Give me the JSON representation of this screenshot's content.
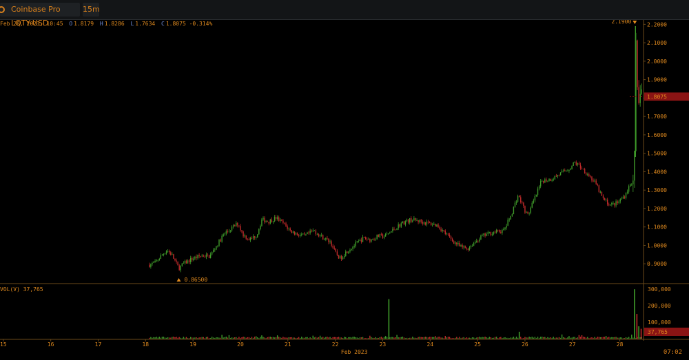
{
  "toolbar": {
    "symbol_tab": "Coinbase Pro LQTY-USD",
    "interval_tab": "15m",
    "settings_icon": "gear-icon"
  },
  "ohlc": {
    "date": "Feb 28, 2023, 10:45",
    "o_label": "O",
    "o": "1.8179",
    "h_label": "H",
    "h": "1.8286",
    "l_label": "L",
    "l": "1.7634",
    "c_label": "C",
    "c": "1.8075",
    "change": "-0.314%"
  },
  "volume_legend": "VOL(V) 37,765",
  "footer_time": "07:02",
  "colors": {
    "up": "#3f9b2a",
    "down": "#c22b2b",
    "accent": "#e08a1e",
    "price_tag": "#8a1414"
  },
  "chart_data": {
    "type": "line",
    "title": "Coinbase Pro LQTY-USD",
    "y_ticks": [
      "0.9000",
      "1.0000",
      "1.1000",
      "1.2000",
      "1.3000",
      "1.4000",
      "1.5000",
      "1.6000",
      "1.7000",
      "1.8000",
      "1.9000",
      "2.0000",
      "2.1000",
      "2.2000"
    ],
    "ylim": [
      0.8,
      2.22
    ],
    "x_ticks": [
      "15",
      "16",
      "17",
      "18",
      "19",
      "20",
      "21",
      "22",
      "23",
      "24",
      "25",
      "26",
      "27",
      "28"
    ],
    "x_month_label": "Feb 2023",
    "xlim": [
      14.93,
      28.5
    ],
    "last_price_label": "1.8075",
    "last_price": 1.8075,
    "high_marker": {
      "label": "2.1900",
      "value": 2.19,
      "x": 28.33
    },
    "low_marker": {
      "label": "0.86500",
      "value": 0.865,
      "x": 18.7
    },
    "price_series": [
      [
        18.08,
        0.895
      ],
      [
        18.2,
        0.905
      ],
      [
        18.3,
        0.935
      ],
      [
        18.45,
        0.975
      ],
      [
        18.55,
        0.95
      ],
      [
        18.7,
        0.875
      ],
      [
        18.8,
        0.9
      ],
      [
        19.0,
        0.93
      ],
      [
        19.2,
        0.945
      ],
      [
        19.35,
        0.94
      ],
      [
        19.5,
        1.0
      ],
      [
        19.65,
        1.06
      ],
      [
        19.8,
        1.09
      ],
      [
        19.95,
        1.12
      ],
      [
        20.05,
        1.06
      ],
      [
        20.2,
        1.03
      ],
      [
        20.35,
        1.06
      ],
      [
        20.45,
        1.14
      ],
      [
        20.6,
        1.13
      ],
      [
        20.75,
        1.15
      ],
      [
        20.9,
        1.12
      ],
      [
        21.05,
        1.08
      ],
      [
        21.2,
        1.06
      ],
      [
        21.35,
        1.05
      ],
      [
        21.55,
        1.08
      ],
      [
        21.75,
        1.04
      ],
      [
        21.9,
        1.02
      ],
      [
        22.0,
        0.96
      ],
      [
        22.1,
        0.93
      ],
      [
        22.25,
        0.97
      ],
      [
        22.45,
        1.01
      ],
      [
        22.6,
        1.04
      ],
      [
        22.75,
        1.03
      ],
      [
        22.9,
        1.05
      ],
      [
        23.05,
        1.05
      ],
      [
        23.2,
        1.08
      ],
      [
        23.4,
        1.12
      ],
      [
        23.6,
        1.14
      ],
      [
        23.8,
        1.13
      ],
      [
        23.95,
        1.12
      ],
      [
        24.15,
        1.11
      ],
      [
        24.3,
        1.07
      ],
      [
        24.5,
        1.02
      ],
      [
        24.65,
        0.99
      ],
      [
        24.8,
        0.985
      ],
      [
        24.95,
        1.02
      ],
      [
        25.1,
        1.05
      ],
      [
        25.3,
        1.07
      ],
      [
        25.55,
        1.08
      ],
      [
        25.7,
        1.16
      ],
      [
        25.85,
        1.27
      ],
      [
        25.95,
        1.22
      ],
      [
        26.05,
        1.16
      ],
      [
        26.2,
        1.25
      ],
      [
        26.35,
        1.35
      ],
      [
        26.55,
        1.36
      ],
      [
        26.75,
        1.39
      ],
      [
        26.95,
        1.42
      ],
      [
        27.05,
        1.45
      ],
      [
        27.2,
        1.42
      ],
      [
        27.35,
        1.38
      ],
      [
        27.5,
        1.33
      ],
      [
        27.65,
        1.25
      ],
      [
        27.8,
        1.22
      ],
      [
        27.95,
        1.23
      ],
      [
        28.1,
        1.27
      ],
      [
        28.2,
        1.32
      ],
      [
        28.27,
        1.35
      ],
      [
        28.31,
        1.48
      ],
      [
        28.33,
        2.19
      ],
      [
        28.36,
        1.85
      ],
      [
        28.4,
        1.76
      ],
      [
        28.44,
        1.88
      ],
      [
        28.48,
        1.81
      ]
    ],
    "volume_ticks": [
      "100,000",
      "200,000",
      "300,000"
    ],
    "volume_ylim": [
      0,
      330000
    ],
    "last_volume_label": "37,765",
    "volume_spikes": [
      [
        23.13,
        240000,
        "up"
      ],
      [
        25.88,
        42000,
        "up"
      ],
      [
        28.31,
        300000,
        "up"
      ],
      [
        28.36,
        150000,
        "down"
      ],
      [
        28.4,
        75000,
        "up"
      ],
      [
        28.45,
        60000,
        "down"
      ]
    ]
  }
}
